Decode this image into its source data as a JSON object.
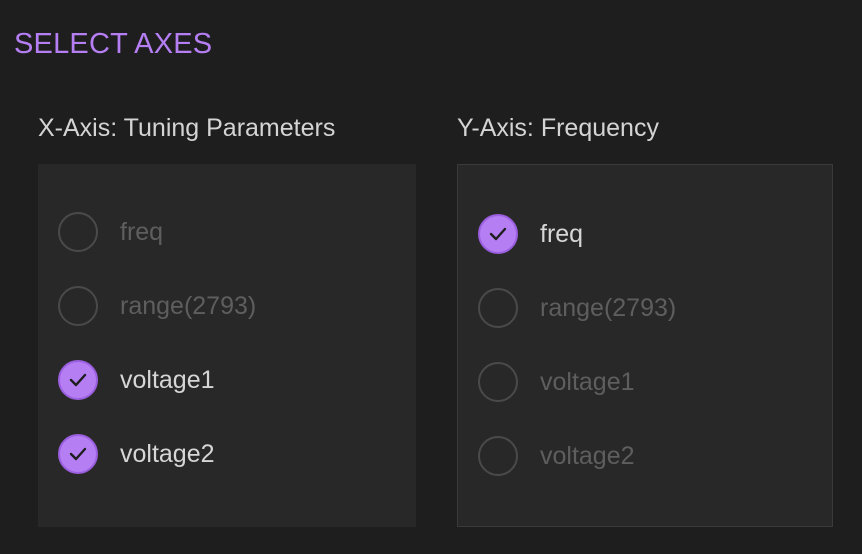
{
  "header": {
    "title": "SELECT AXES"
  },
  "x_axis": {
    "label": "X-Axis: Tuning Parameters",
    "options": [
      {
        "label": "freq",
        "checked": false
      },
      {
        "label": "range(2793)",
        "checked": false
      },
      {
        "label": "voltage1",
        "checked": true
      },
      {
        "label": "voltage2",
        "checked": true
      }
    ]
  },
  "y_axis": {
    "label": "Y-Axis: Frequency",
    "options": [
      {
        "label": "freq",
        "checked": true
      },
      {
        "label": "range(2793)",
        "checked": false
      },
      {
        "label": "voltage1",
        "checked": false
      },
      {
        "label": "voltage2",
        "checked": false
      }
    ]
  },
  "colors": {
    "accent": "#b57ef3",
    "background": "#1e1e1e",
    "panel": "#282828",
    "text_active": "#d6d6d6",
    "text_inactive": "#5e5e5e"
  },
  "icons": {
    "checked_mark": "check-icon"
  }
}
